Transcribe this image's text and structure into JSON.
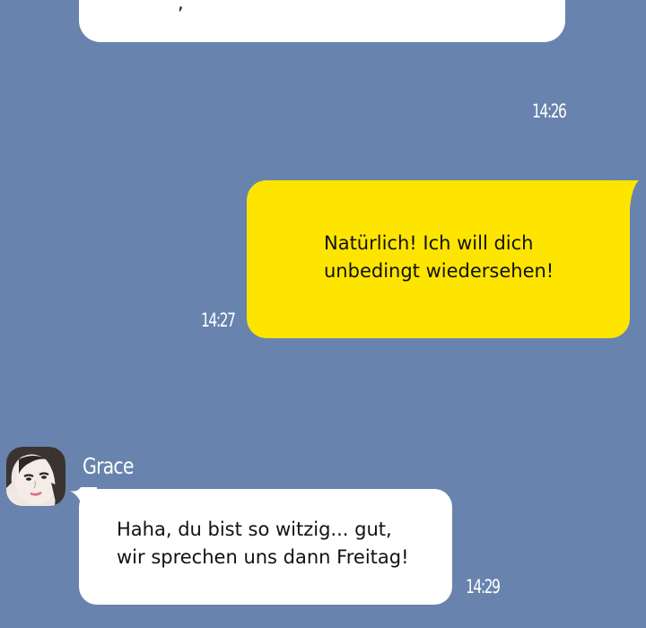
{
  "colors": {
    "background": "#6883ad",
    "outgoing_bubble": "#fee500",
    "incoming_bubble": "#ffffff",
    "timestamp_text": "#ffffff"
  },
  "chat": {
    "previous_message": {
      "visible_text": ","
    },
    "timestamps": [
      "14:26",
      "14:27",
      "14:29"
    ],
    "outgoing_message": {
      "lines": [
        "Natürlich! Ich will dich",
        "unbedingt wiedersehen!"
      ],
      "time": "14:27"
    },
    "incoming_message": {
      "sender": "Grace",
      "avatar_icon": "contact-avatar-photo",
      "lines": [
        "Haha, du bist so witzig... gut,",
        "wir sprechen uns dann Freitag!"
      ],
      "time": "14:29"
    }
  }
}
